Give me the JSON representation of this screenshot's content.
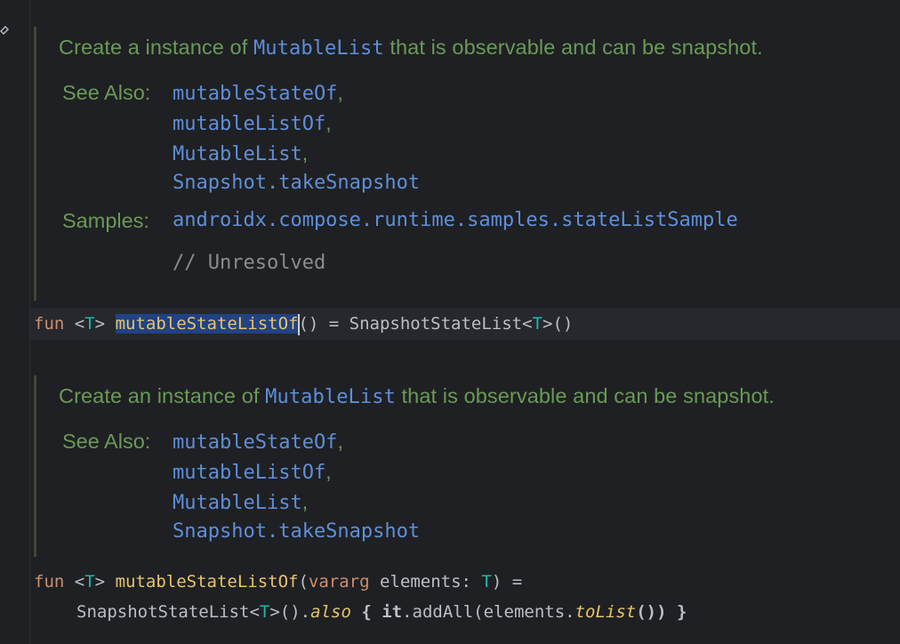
{
  "doc1": {
    "desc_before": "Create a instance of ",
    "desc_code": "MutableList",
    "desc_after": " that is observable and can be snapshot.",
    "see_also_label": "See Also:",
    "see_also": [
      "mutableStateOf",
      "mutableListOf",
      "MutableList",
      "Snapshot.takeSnapshot"
    ],
    "samples_label": "Samples:",
    "sample": "androidx.compose.runtime.samples.stateListSample",
    "sample_comment": "// Unresolved"
  },
  "code1": {
    "kw_fun": "fun",
    "lt": " <",
    "type_param": "T",
    "gt": "> ",
    "fn_name": "mutableStateListOf",
    "after_name": "() = SnapshotStateList<",
    "type_param2": "T",
    "end": ">()"
  },
  "doc2": {
    "desc_before": "Create an instance of ",
    "desc_code": "MutableList",
    "desc_after": " that is observable and can be snapshot.",
    "see_also_label": "See Also:",
    "see_also": [
      "mutableStateOf",
      "mutableListOf",
      "MutableList",
      "Snapshot.takeSnapshot"
    ]
  },
  "code2": {
    "kw_fun": "fun",
    "lt": " <",
    "type_param": "T",
    "gt": "> ",
    "fn_name": "mutableStateListOf",
    "open": "(",
    "kw_vararg": "vararg",
    "param": " elements: ",
    "type_param2": "T",
    "close": ") =",
    "line2_start": "SnapshotStateList<",
    "type_param3": "T",
    "line2_mid": ">().",
    "also": "also",
    "brace_open": " { ",
    "it": "it",
    "add_all": ".addAll(elements.",
    "to_list": "toList",
    "line2_end": "()) }"
  },
  "colors": {
    "background": "#1f2023",
    "doc_text": "#6a9a57",
    "doc_link": "#5e8fd9",
    "keyword": "#cf8e6d",
    "type_param": "#16baac",
    "function_decl": "#e8c46a",
    "selection": "#214283"
  }
}
